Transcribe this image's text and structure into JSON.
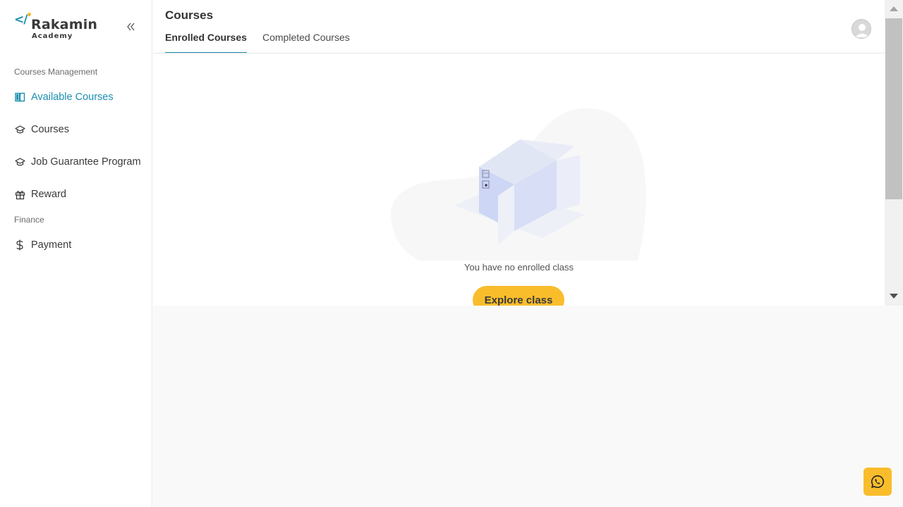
{
  "brand": {
    "mark": "</",
    "name": "Rakamin",
    "sub": "Academy",
    "accent_color": "#1a8fb0",
    "dot_color": "#f5b82e"
  },
  "sidebar": {
    "collapse_icon": "double-chevron-left-icon",
    "sections": [
      {
        "label": "Courses Management"
      },
      {
        "label": "Finance"
      }
    ],
    "items": [
      {
        "label": "Available Courses",
        "icon": "book-icon",
        "active": true
      },
      {
        "label": "Courses",
        "icon": "graduation-cap-icon",
        "active": false
      },
      {
        "label": "Job Guarantee Program",
        "icon": "graduation-cap-icon",
        "active": false
      },
      {
        "label": "Reward",
        "icon": "gift-icon",
        "active": false
      },
      {
        "label": "Payment",
        "icon": "dollar-icon",
        "active": false
      }
    ]
  },
  "header": {
    "title": "Courses",
    "tabs": [
      {
        "label": "Enrolled Courses",
        "active": true
      },
      {
        "label": "Completed Courses",
        "active": false
      }
    ],
    "avatar_icon": "user-avatar-icon"
  },
  "empty_state": {
    "illustration": "empty-box-illustration",
    "message": "You have no enrolled class",
    "button_label": "Explore class",
    "button_color": "#f9bd2c"
  },
  "floating": {
    "whatsapp_icon": "whatsapp-icon"
  }
}
